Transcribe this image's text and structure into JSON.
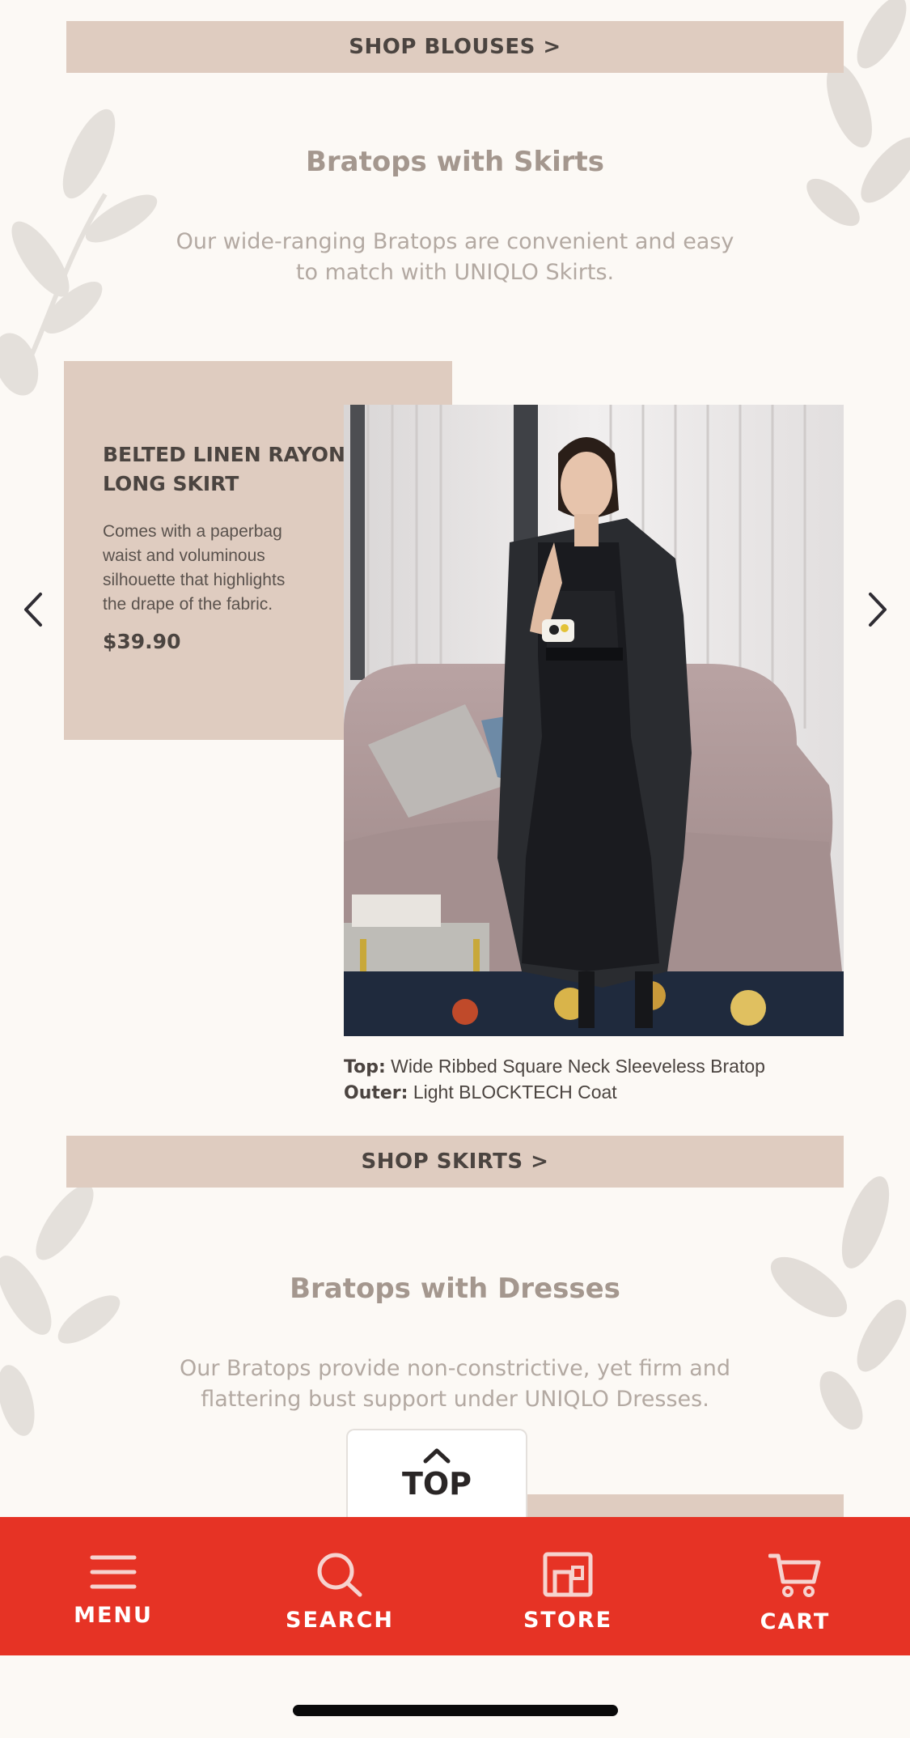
{
  "blouses_section": {
    "shop_label": "SHOP BLOUSES >"
  },
  "skirts_section": {
    "title": "Bratops with Skirts",
    "description": "Our wide-ranging Bratops are convenient and easy to match with UNIQLO Skirts.",
    "product": {
      "name": "BELTED LINEN RAYON LONG SKIRT",
      "description": "Comes with a paperbag waist and voluminous silhouette that highlights the drape of the fabric.",
      "price": "$39.90"
    },
    "caption": {
      "top_label": "Top:",
      "top_value": "Wide Ribbed Square Neck Sleeveless Bratop",
      "outer_label": "Outer:",
      "outer_value": "Light BLOCKTECH Coat"
    },
    "shop_label": "SHOP SKIRTS >"
  },
  "dresses_section": {
    "title": "Bratops with Dresses",
    "description": "Our Bratops provide non-constrictive, yet firm and flattering bust support under UNIQLO Dresses."
  },
  "top_button": {
    "label": "TOP"
  },
  "bottom_nav": {
    "items": [
      {
        "label": "MENU",
        "icon": "menu-icon"
      },
      {
        "label": "SEARCH",
        "icon": "search-icon"
      },
      {
        "label": "STORE",
        "icon": "store-icon"
      },
      {
        "label": "CART",
        "icon": "cart-icon"
      }
    ]
  },
  "colors": {
    "background": "#fcf9f5",
    "card": "#dfccc0",
    "nav": "#e63325",
    "title": "#a4978e"
  }
}
